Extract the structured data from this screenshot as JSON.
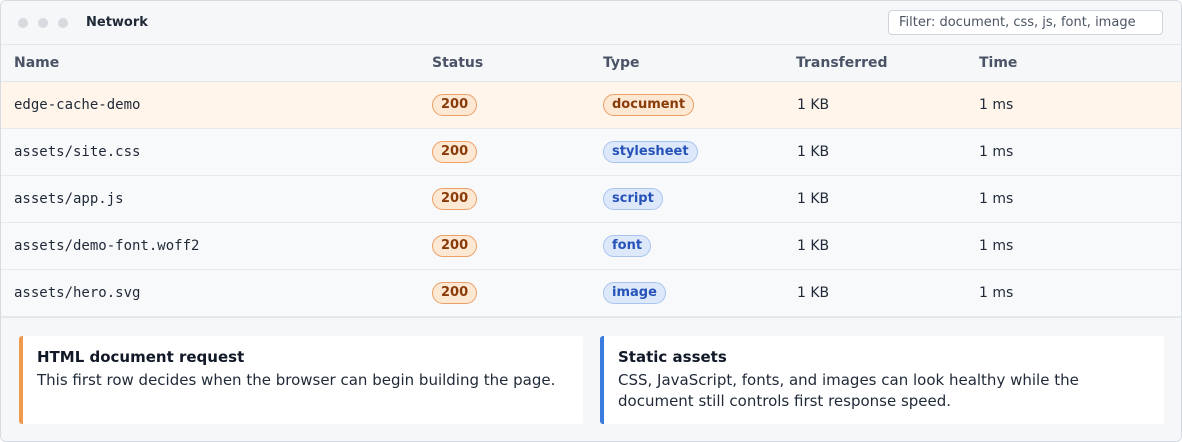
{
  "window": {
    "title": "Network"
  },
  "filter": {
    "placeholder": "Filter: document, css, js, font, image",
    "value": ""
  },
  "columns": {
    "name": "Name",
    "status": "Status",
    "type": "Type",
    "transferred": "Transferred",
    "time": "Time"
  },
  "rows": [
    {
      "name": "edge-cache-demo",
      "status": "200",
      "type": "document",
      "transferred": "1 KB",
      "time": "1 ms",
      "selected": true
    },
    {
      "name": "assets/site.css",
      "status": "200",
      "type": "stylesheet",
      "transferred": "1 KB",
      "time": "1 ms",
      "selected": false
    },
    {
      "name": "assets/app.js",
      "status": "200",
      "type": "script",
      "transferred": "1 KB",
      "time": "1 ms",
      "selected": false
    },
    {
      "name": "assets/demo-font.woff2",
      "status": "200",
      "type": "font",
      "transferred": "1 KB",
      "time": "1 ms",
      "selected": false
    },
    {
      "name": "assets/hero.svg",
      "status": "200",
      "type": "image",
      "transferred": "1 KB",
      "time": "1 ms",
      "selected": false
    }
  ],
  "cards": [
    {
      "title": "HTML document request",
      "body": "This first row decides when the browser can begin building the page.",
      "accent": "#ef9a4f"
    },
    {
      "title": "Static assets",
      "body": "CSS, JavaScript, fonts, and images can look healthy while the document still controls first response speed.",
      "accent": "#3b7be0"
    }
  ],
  "colors": {
    "selected_row": "#fff5eb",
    "status_pill": "#fde8d4",
    "asset_pill": "#dde9fb"
  }
}
